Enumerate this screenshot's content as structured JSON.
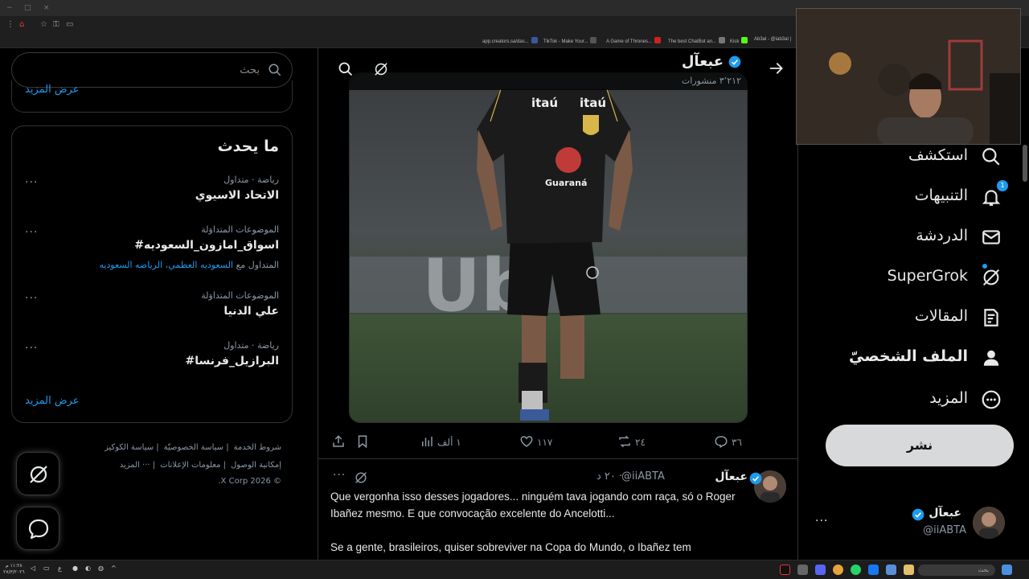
{
  "browser": {
    "bookmarks": [
      {
        "label": "app.creators.sa/das...",
        "color": "#3b5998"
      },
      {
        "label": "TikTok - Make Your...",
        "color": "#111111"
      },
      {
        "label": "A Game of Thrones...",
        "color": "#777777"
      },
      {
        "label": "The best ChatBot an...",
        "color": "#cc2222"
      },
      {
        "label": "Kick",
        "color": "#53fc18"
      },
      {
        "label": "Ab3al - @iab3al |",
        "color": "#444444"
      }
    ]
  },
  "search": {
    "placeholder": "بحث"
  },
  "previous_card": {
    "show_more": "عرض المزيد"
  },
  "trends": {
    "title": "ما يحدث",
    "items": [
      {
        "meta": "رياضة · متداول",
        "name": "الاتحاد الاسيوي",
        "sub_prefix": "",
        "sub_links": ""
      },
      {
        "meta": "الموضوعات المتداوَلة",
        "name": "#اسواق_امازون_السعوديه",
        "sub_prefix": "المتداول مع ",
        "sub_links": "السعوديه العظمي، الرياضه السعوديه"
      },
      {
        "meta": "الموضوعات المتداوَلة",
        "name": "علي الدنيا",
        "sub_prefix": "",
        "sub_links": ""
      },
      {
        "meta": "رياضة · متداول",
        "name": "#البرازيل_فرنسا",
        "sub_prefix": "",
        "sub_links": ""
      }
    ],
    "show_more": "عرض المزيد",
    "more_dots": "···"
  },
  "footer": {
    "links": [
      "شروط الخدمة",
      "سياسة الخصوصيّة",
      "سياسة الكوكيز",
      "إمكانية الوصول",
      "معلومات الإعلانات",
      "··· المزيد"
    ],
    "copyright": "© 2026 X Corp."
  },
  "post_header": {
    "name": "عبعآل",
    "posts_count": "٣٬٢١٢ منشورات"
  },
  "media": {
    "shirt_text_1": "itaú",
    "shirt_text_2": "itaú",
    "shirt_text_3": "Guaraná",
    "bg_text": "Ub"
  },
  "actions": {
    "replies": "٣٦",
    "reposts": "٢٤",
    "likes": "١١٧",
    "views": "١ ألف"
  },
  "reply": {
    "name": "عبعآل",
    "handle": "@iiABTA",
    "time": "٢٠ د ·",
    "text": "Que vergonha isso desses jogadores... ninguém tava jogando com raça, só o Roger Ibañez mesmo. E que convocação excelente do Ancelotti...\n\nSe a gente, brasileiros, quiser sobreviver na Copa do Mundo, o Ibañez tem",
    "more_dots": "···"
  },
  "nav": {
    "items": [
      {
        "label": "استكشف",
        "icon": "search-icon"
      },
      {
        "label": "التنبيهات",
        "icon": "bell-icon",
        "badge": "1"
      },
      {
        "label": "الدردشة",
        "icon": "mail-icon"
      },
      {
        "label": "SuperGrok",
        "icon": "grok-icon"
      },
      {
        "label": "المقالات",
        "icon": "article-icon"
      },
      {
        "label": "الملف الشخصيّ",
        "icon": "profile-icon"
      },
      {
        "label": "المزيد",
        "icon": "more-circle-icon"
      }
    ],
    "post_button": "نشر"
  },
  "account": {
    "name": "عبعآل",
    "handle": "@iiABTA",
    "more_dots": "···"
  },
  "taskbar": {
    "search_placeholder": "بحث",
    "clock_time": "١١:٢٨ م",
    "clock_date": "٢٧/٣/٢٠٢٦",
    "lang": "ع"
  },
  "colors": {
    "accent": "#1d9bf0",
    "background": "#000000",
    "border": "#2f3336",
    "muted": "#8b98a5"
  }
}
